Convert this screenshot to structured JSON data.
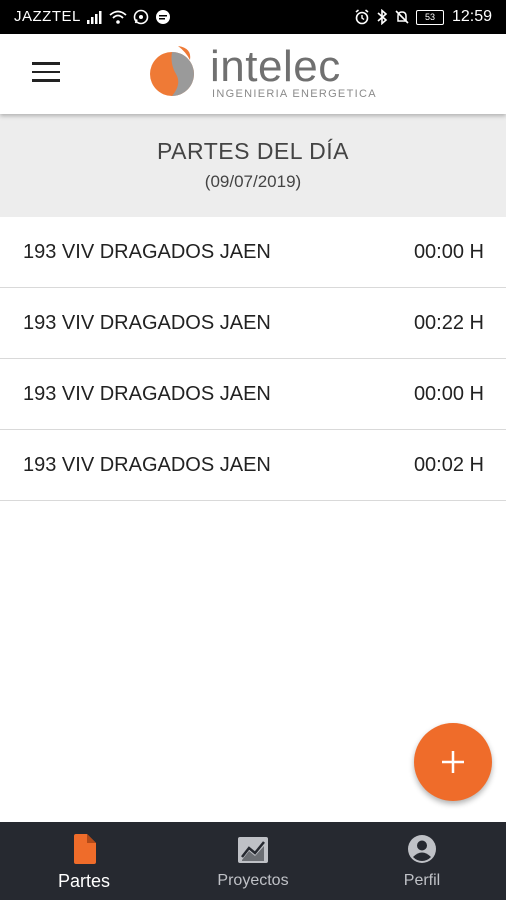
{
  "status_bar": {
    "carrier": "JAZZTEL",
    "battery": "53",
    "time": "12:59"
  },
  "app_bar": {
    "logo_text": "intelec",
    "logo_subtitle": "INGENIERIA ENERGETICA",
    "brand_color": "#ef6c2a"
  },
  "header": {
    "title": "PARTES DEL DÍA",
    "date": "(09/07/2019)"
  },
  "partes": [
    {
      "name": "193 VIV DRAGADOS JAEN",
      "time": "00:00 H"
    },
    {
      "name": "193 VIV DRAGADOS JAEN",
      "time": "00:22 H"
    },
    {
      "name": "193 VIV DRAGADOS JAEN",
      "time": "00:00 H"
    },
    {
      "name": "193 VIV DRAGADOS JAEN",
      "time": "00:02 H"
    }
  ],
  "fab": {
    "icon": "plus-icon"
  },
  "bottom_nav": {
    "items": [
      {
        "label": "Partes",
        "icon": "document-icon",
        "active": true
      },
      {
        "label": "Proyectos",
        "icon": "chart-icon",
        "active": false
      },
      {
        "label": "Perfil",
        "icon": "account-circle-icon",
        "active": false
      }
    ]
  }
}
